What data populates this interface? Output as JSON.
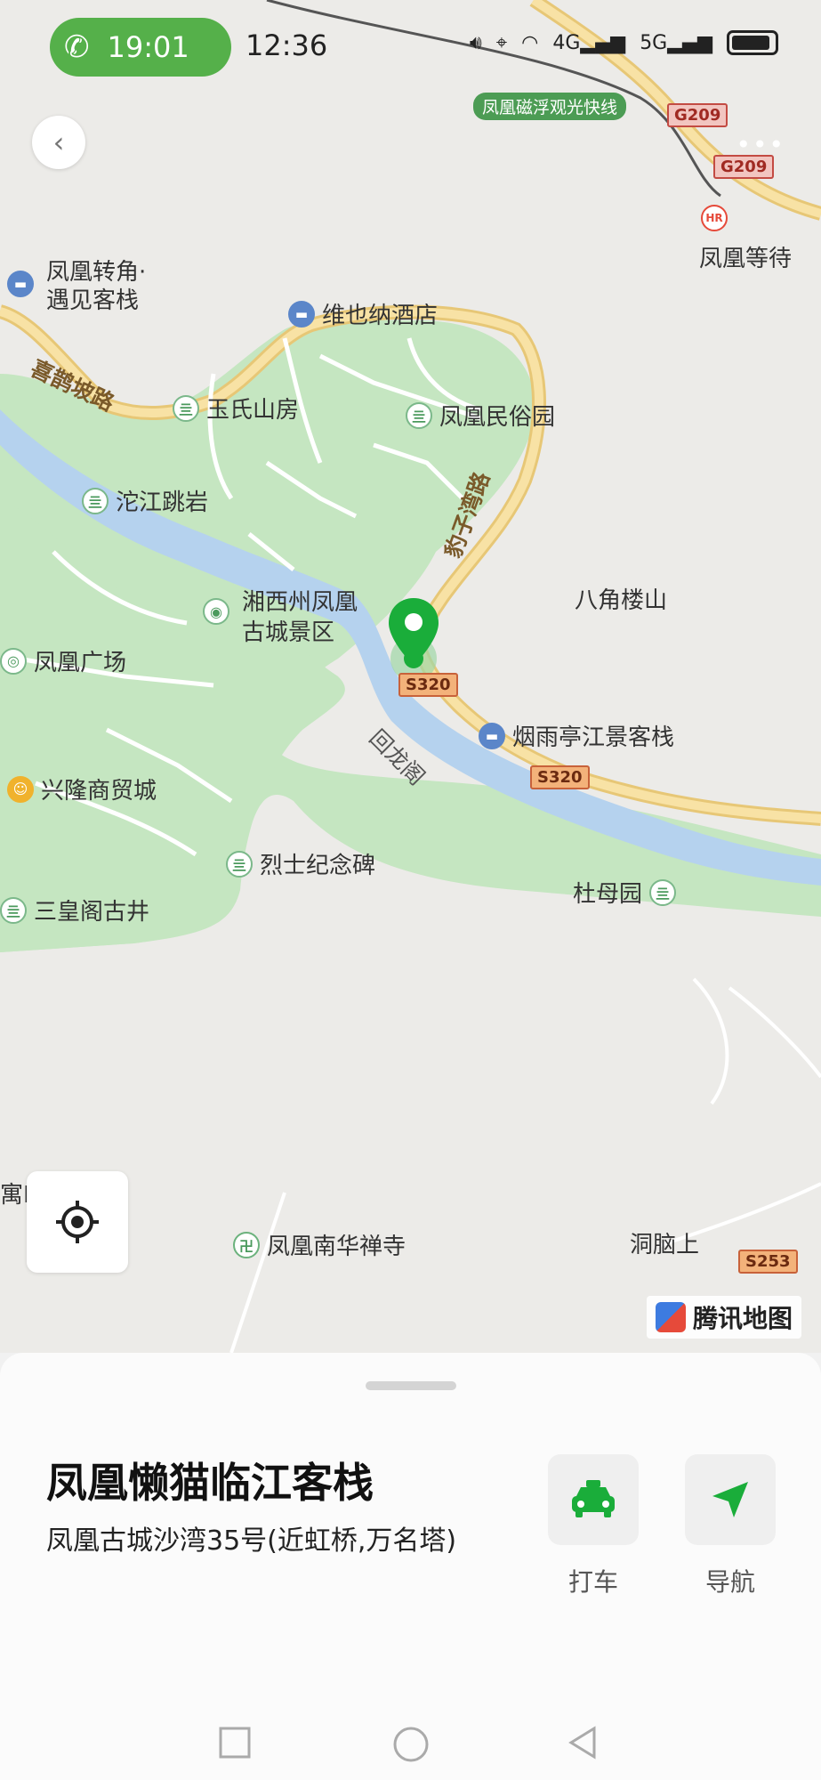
{
  "status_bar": {
    "call_time": "19:01",
    "clock": "12:36",
    "network_4g": "4G",
    "network_5g": "5G"
  },
  "map": {
    "labels": {
      "maglev": "凤凰磁浮观光快线",
      "g209_a": "G209",
      "g209_b": "G209",
      "waiting": "凤凰等待",
      "zhuanjiao_1": "凤凰转角·",
      "zhuanjiao_2": "遇见客栈",
      "vienna": "维也纳酒店",
      "xique_road": "喜鹊坡路",
      "yushi": "玉氏山房",
      "minsu": "凤凰民俗园",
      "tuojiang": "沱江跳岩",
      "baozi_road": "豹子湾路",
      "scenic_1": "湘西州凤凰",
      "scenic_2": "古城景区",
      "bajiao": "八角楼山",
      "guangchang": "凤凰广场",
      "s320_a": "S320",
      "s320_b": "S320",
      "yanyuting": "烟雨亭江景客栈",
      "huilongge": "回龙阁",
      "xinglong": "兴隆商贸城",
      "lieshi": "烈士纪念碑",
      "dumu": "杜母园",
      "sanhuang": "三皇阁古井",
      "nanhua": "凤凰南华禅寺",
      "dongnao": "洞脑上",
      "s253": "S253",
      "yu": "寓E"
    },
    "provider": "腾讯地图"
  },
  "place": {
    "name": "凤凰懒猫临江客栈",
    "address": "凤凰古城沙湾35号(近虹桥,万名塔)"
  },
  "actions": {
    "taxi_label": "打车",
    "navigate_label": "导航"
  },
  "colors": {
    "brand_green": "#1aad3a",
    "river": "#b8d3ec",
    "park": "#c6e7c3",
    "road": "#f6dc9a"
  }
}
